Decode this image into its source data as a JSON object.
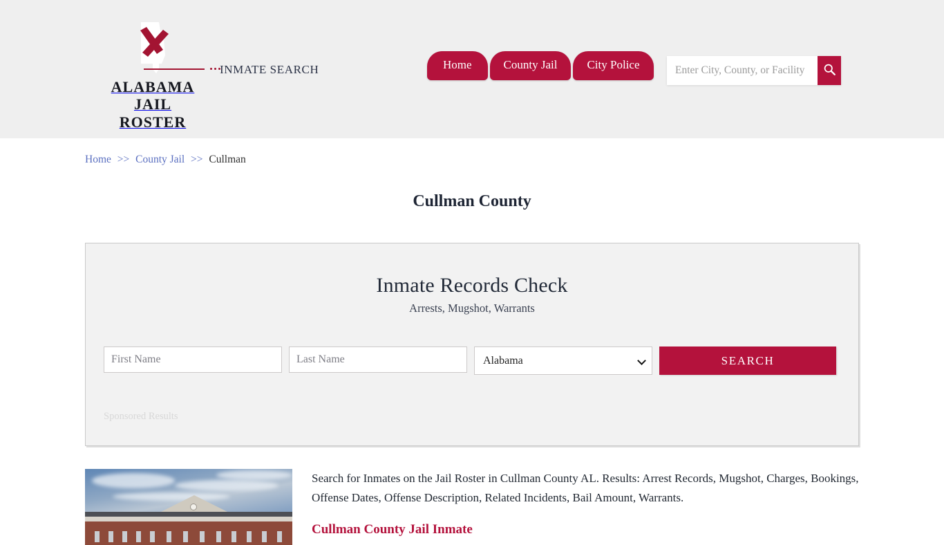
{
  "header": {
    "logo": {
      "line1": "ALABAMA",
      "line2": "JAIL ROSTER",
      "alt": "alabama-state-outline-with-crimson-x"
    },
    "tagline": "INMATE SEARCH",
    "nav": [
      {
        "label": "Home"
      },
      {
        "label": "County Jail"
      },
      {
        "label": "City Police"
      }
    ],
    "search": {
      "placeholder": "Enter City, County, or Facility",
      "value": "",
      "button_icon": "search-icon"
    }
  },
  "breadcrumb": {
    "items": [
      {
        "label": "Home",
        "link": true
      },
      {
        "label": "County Jail",
        "link": true
      },
      {
        "label": "Cullman",
        "link": false
      }
    ],
    "separator": ">>"
  },
  "page": {
    "title": "Cullman County"
  },
  "panel": {
    "heading": "Inmate Records Check",
    "subheading": "Arrests, Mugshot, Warrants",
    "form": {
      "first_name_placeholder": "First Name",
      "first_name_value": "",
      "last_name_placeholder": "Last Name",
      "last_name_value": "",
      "state_selected": "Alabama",
      "state_options": [
        "Alabama"
      ],
      "search_button": "SEARCH"
    },
    "sponsored_label": "Sponsored Results"
  },
  "content": {
    "image_alt": "cullman-county-courthouse-photo",
    "paragraph": "Search for Inmates on the Jail Roster in Cullman County AL. Results: Arrest Records, Mugshot, Charges, Bookings, Offense Dates, Offense Description, Related Incidents, Bail Amount, Warrants.",
    "section_link": "Cullman County Jail Inmate"
  },
  "colors": {
    "brand_crimson": "#b4123c",
    "header_bg": "#efefef",
    "panel_bg": "#f2f2f2",
    "link_blue": "#5a6fc0",
    "title_navy": "#1d2433"
  }
}
